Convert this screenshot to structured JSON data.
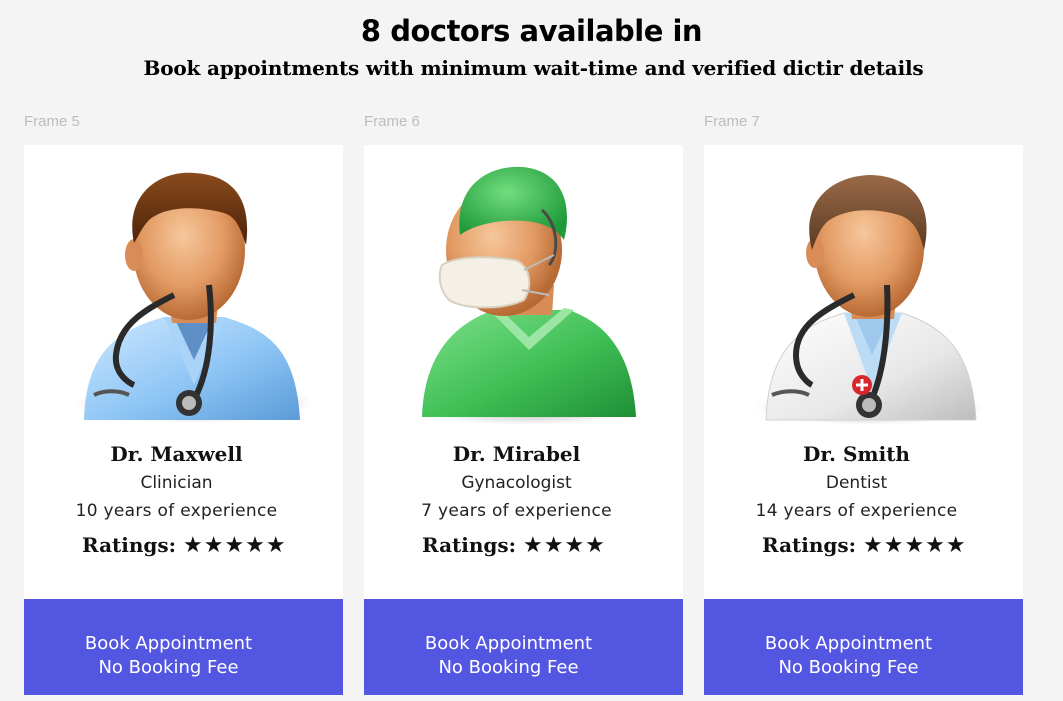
{
  "header": {
    "title": "8 doctors available in",
    "subtitle": "Book appointments with minimum wait-time and verified dictir details"
  },
  "cards": [
    {
      "frame_label": "Frame 5",
      "name": "Dr. Maxwell",
      "specialty": "Clinician",
      "experience": "10 years of experience",
      "ratings_label": "Ratings:",
      "stars": "★★★★★",
      "rating": 5,
      "avatar": "doctor-blue-coat-icon",
      "cta_line1": "Book Appointment",
      "cta_line2": "No Booking Fee"
    },
    {
      "frame_label": "Frame 6",
      "name": "Dr. Mirabel",
      "specialty": "Gynacologist",
      "experience": "7 years of experience",
      "ratings_label": "Ratings:",
      "stars": "★★★★",
      "rating": 4,
      "avatar": "surgeon-green-scrubs-icon",
      "cta_line1": "Book Appointment",
      "cta_line2": "No Booking Fee"
    },
    {
      "frame_label": "Frame 7",
      "name": "Dr. Smith",
      "specialty": "Dentist",
      "experience": "14 years of experience",
      "ratings_label": "Ratings:",
      "stars": "★★★★★",
      "rating": 5,
      "avatar": "doctor-white-coat-icon",
      "cta_line1": "Book Appointment",
      "cta_line2": "No Booking Fee"
    }
  ],
  "colors": {
    "cta_background": "#5356e0",
    "page_background": "#f4f4f4",
    "card_background": "#ffffff"
  }
}
